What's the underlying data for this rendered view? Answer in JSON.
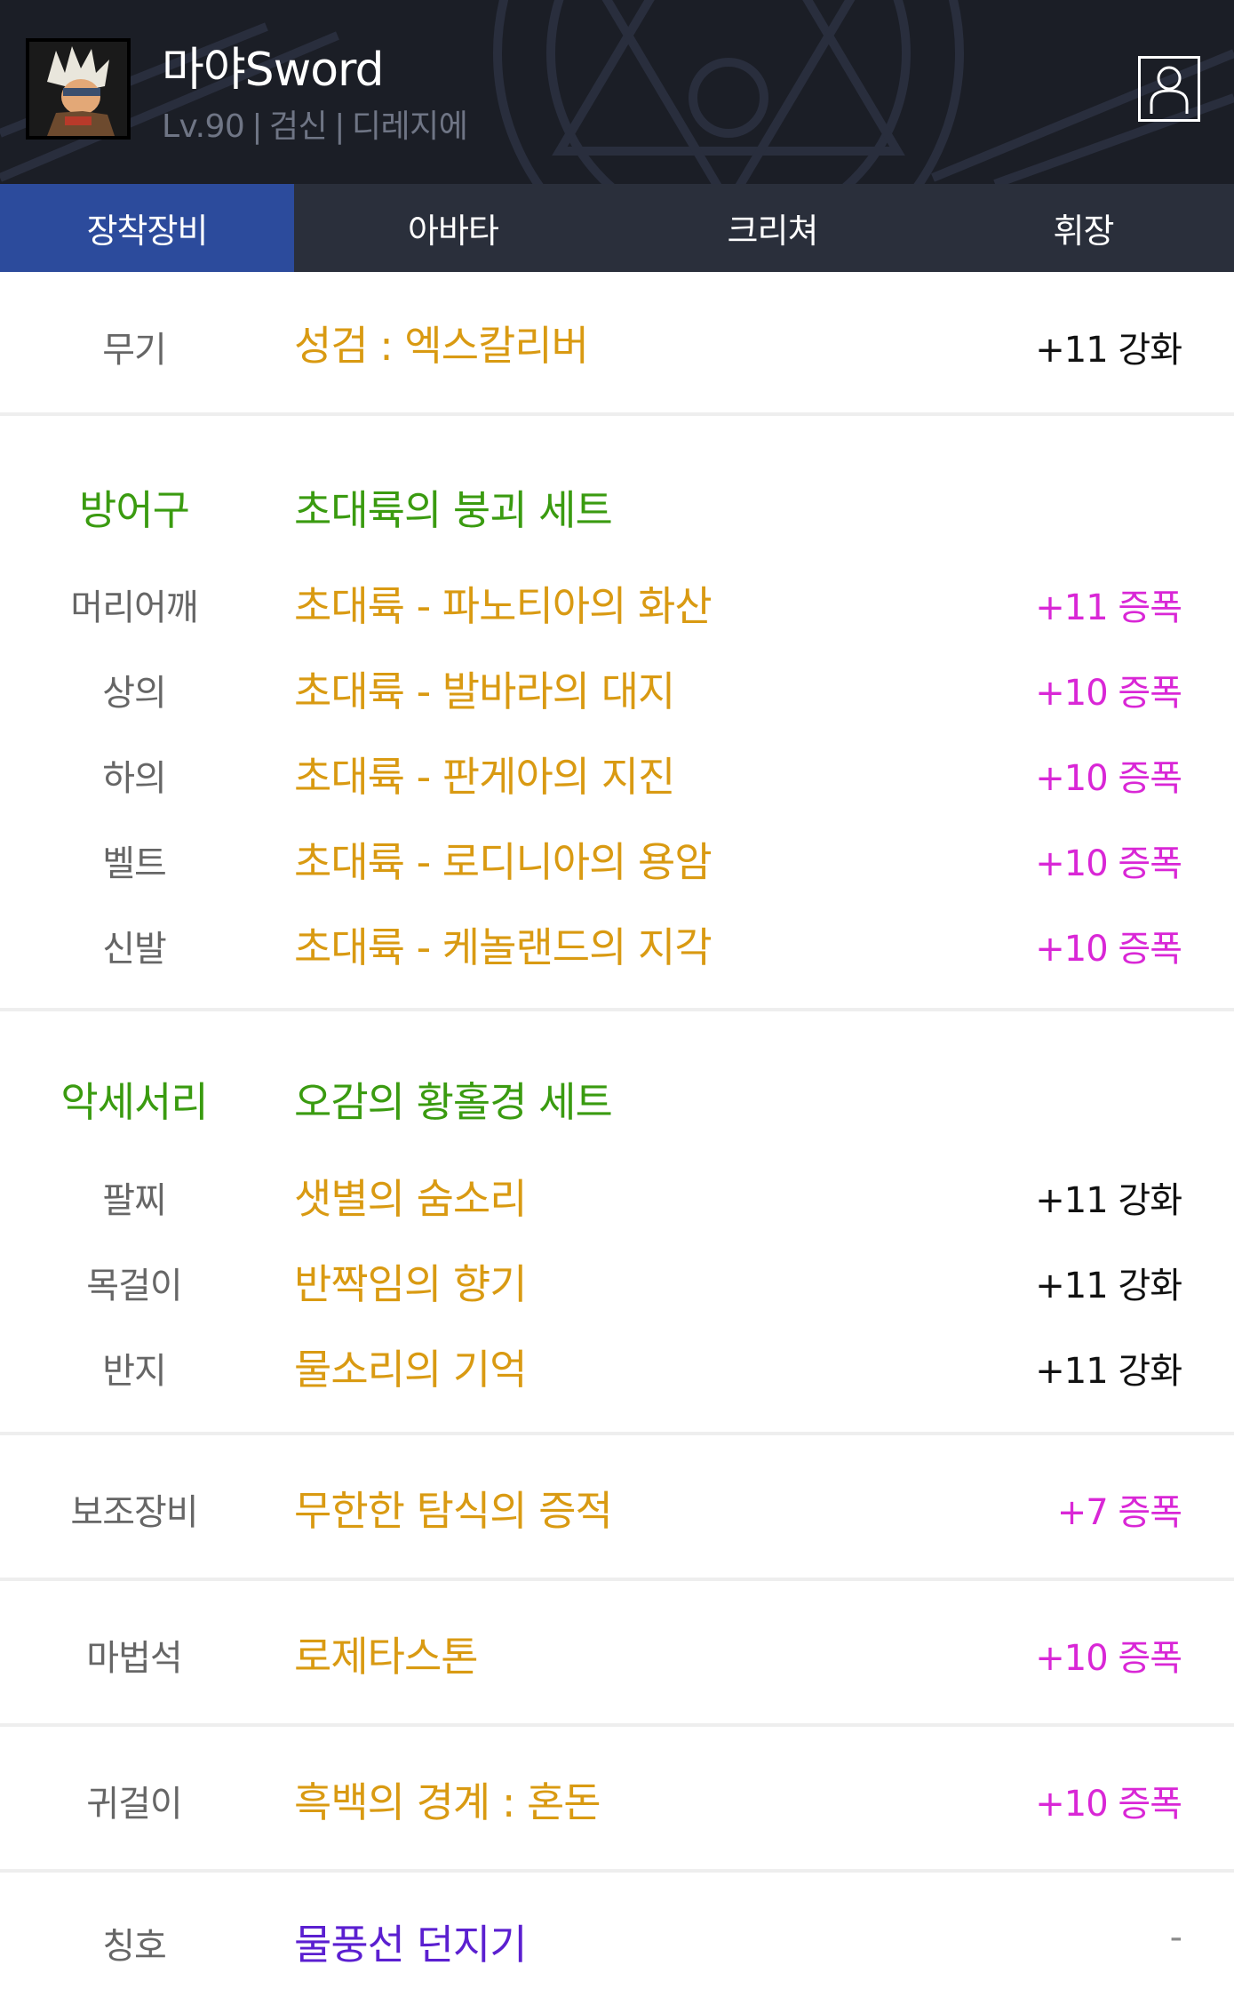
{
  "profile": {
    "name": "마야Sword",
    "level": "Lv.90",
    "job": "검신",
    "server": "디레지에",
    "sep": "|"
  },
  "tabs": [
    {
      "label": "장착장비",
      "active": true
    },
    {
      "label": "아바타",
      "active": false
    },
    {
      "label": "크리쳐",
      "active": false
    },
    {
      "label": "휘장",
      "active": false
    }
  ],
  "weapon": {
    "slot": "무기",
    "name": "성검 : 엑스칼리버",
    "enhance": "+11 강화"
  },
  "armor": {
    "category": "방어구",
    "set_name": "초대륙의 붕괴 세트",
    "items": [
      {
        "slot": "머리어깨",
        "name": "초대륙 - 파노티아의 화산",
        "enhance": "+11 증폭"
      },
      {
        "slot": "상의",
        "name": "초대륙 - 발바라의 대지",
        "enhance": "+10 증폭"
      },
      {
        "slot": "하의",
        "name": "초대륙 - 판게아의 지진",
        "enhance": "+10 증폭"
      },
      {
        "slot": "벨트",
        "name": "초대륙 - 로디니아의 용암",
        "enhance": "+10 증폭"
      },
      {
        "slot": "신발",
        "name": "초대륙 - 케놀랜드의 지각",
        "enhance": "+10 증폭"
      }
    ]
  },
  "accessory": {
    "category": "악세서리",
    "set_name": "오감의 황홀경 세트",
    "items": [
      {
        "slot": "팔찌",
        "name": "샛별의 숨소리",
        "enhance": "+11 강화"
      },
      {
        "slot": "목걸이",
        "name": "반짝임의 향기",
        "enhance": "+11 강화"
      },
      {
        "slot": "반지",
        "name": "물소리의 기억",
        "enhance": "+11 강화"
      }
    ]
  },
  "sub": {
    "slot": "보조장비",
    "name": "무한한 탐식의 증적",
    "enhance": "+7 증폭"
  },
  "magicstone": {
    "slot": "마법석",
    "name": "로제타스톤",
    "enhance": "+10 증폭"
  },
  "earring": {
    "slot": "귀걸이",
    "name": "흑백의 경계 : 혼돈",
    "enhance": "+10 증폭"
  },
  "title": {
    "slot": "칭호",
    "name": "물풍선 던지기",
    "enhance": "-"
  },
  "colors": {
    "item_gold": "#d99a12",
    "set_green": "#3a9b10",
    "amp_magenta": "#d927d6",
    "title_purple": "#5b1fd0",
    "tab_active": "#2c4b9c",
    "tab_bar": "#2a2f3b",
    "header_bg": "#1b1e26"
  },
  "icons": {
    "profile": "person-outline-icon",
    "avatar": "character-portrait"
  }
}
